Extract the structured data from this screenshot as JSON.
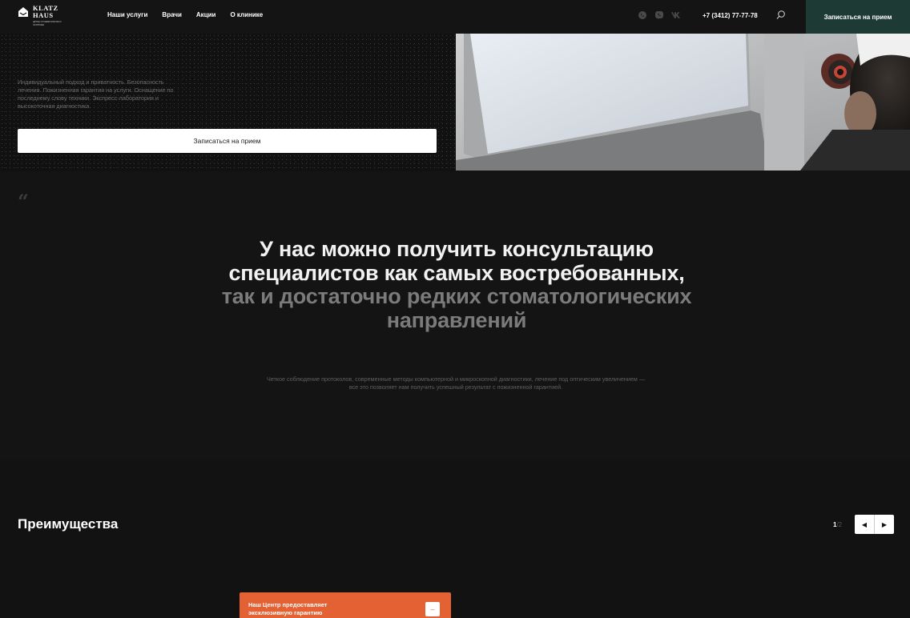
{
  "header": {
    "logo_line1": "KLATZ",
    "logo_line2": "HAUS",
    "logo_tagline": "центр стоматологии и эстетики",
    "nav": [
      "Наши услуги",
      "Врачи",
      "Акции",
      "О клинике"
    ],
    "social_icons": [
      "whatsapp-icon",
      "viber-icon",
      "vk-icon"
    ],
    "phone": "+7 (3412) 77-77-78",
    "cta_label": "Записаться на прием"
  },
  "hero": {
    "text": "Индивидуальный подход и приватность. Безопасность лечения. Пожизненная гарантия на услуги. Оснащение по последнему слову техники. Экспресс-лаборатория и высокоточная диагностика.",
    "button_label": "Записаться на прием"
  },
  "quote": {
    "mark": "“",
    "headline_bright": "У нас можно получить консультацию специалистов как самых востребованных,",
    "headline_dim": " так и достаточно редких стоматологических направлений",
    "subtext": "Четкое соблюдение протоколов, современные методы компьютерной и микроскопной диагностики, лечение под оптическим увеличением — все это позволяет нам получить успешный результат с пожизненной гарантией."
  },
  "advantages": {
    "title": "Преимущества",
    "pager_current": "1",
    "pager_total": "/2",
    "prev_symbol": "◀",
    "next_symbol": "▶",
    "card_text": "Наш Центр предоставляет эксклюзивную гарантию",
    "card_button_symbol": "–"
  },
  "colors": {
    "background": "#141414",
    "cta_green": "#1e3a34",
    "card_orange": "#e36133"
  }
}
